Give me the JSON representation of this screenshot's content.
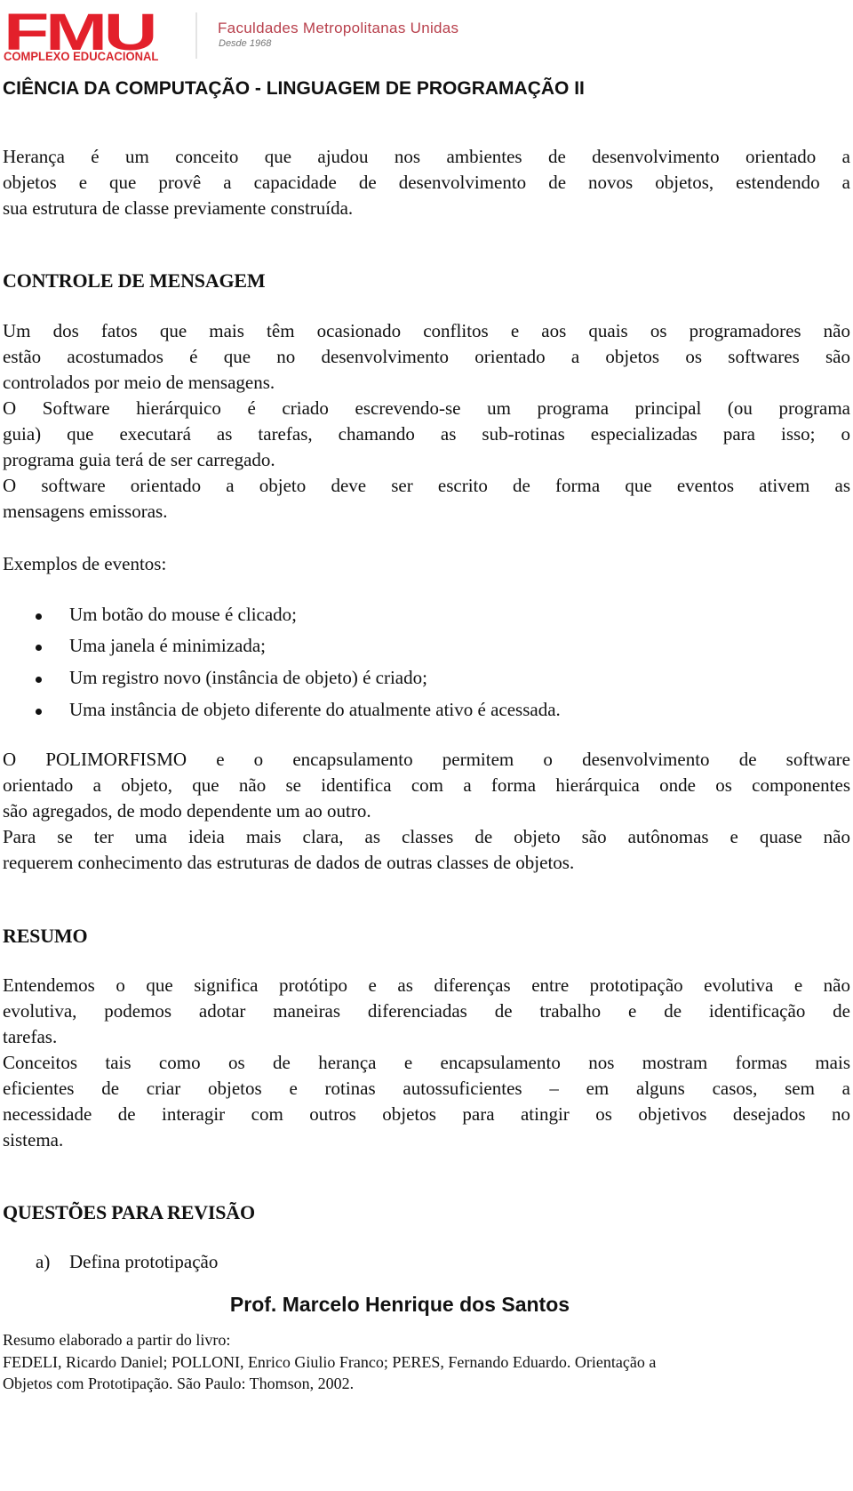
{
  "header": {
    "logo_text": "FMU",
    "logo_subtitle": "COMPLEXO EDUCACIONAL",
    "institution_name": "Faculdades Metropolitanas Unidas",
    "institution_since": "Desde 1968",
    "course_title": "CIÊNCIA DA COMPUTAÇÃO - LINGUAGEM DE PROGRAMAÇÃO II",
    "colors": {
      "brand_red": "#e3202b",
      "institution_text": "#b8404c"
    }
  },
  "intro": {
    "lines": [
      "Herança é um conceito que ajudou nos ambientes de desenvolvimento orientado a",
      "objetos e que provê a capacidade de desenvolvimento de novos objetos, estendendo a",
      "sua estrutura de classe previamente construída."
    ]
  },
  "controle": {
    "heading": "CONTROLE DE MENSAGEM",
    "paragraphs": [
      {
        "lines": [
          "Um dos fatos que mais têm ocasionado conflitos e aos quais os programadores não",
          "estão acostumados é que no desenvolvimento orientado a objetos os softwares são",
          "controlados por meio de mensagens."
        ]
      },
      {
        "lines": [
          "O Software hierárquico é criado escrevendo-se um programa principal (ou programa",
          "guia) que executará as tarefas, chamando as sub-rotinas especializadas para isso; o",
          "programa guia terá de ser carregado."
        ]
      },
      {
        "lines": [
          "O software orientado a objeto deve ser escrito de forma que eventos ativem as",
          "mensagens emissoras."
        ]
      }
    ],
    "examples_label": "Exemplos de eventos:",
    "examples": [
      "Um botão do mouse é clicado;",
      "Uma janela é minimizada;",
      "Um registro novo (instância de objeto) é criado;",
      "Uma instância de objeto diferente do atualmente ativo é acessada."
    ],
    "closing": [
      {
        "lines": [
          "O POLIMORFISMO e o encapsulamento permitem o desenvolvimento de software",
          "orientado a objeto, que não se identifica com a forma hierárquica onde os componentes",
          "são agregados, de modo dependente um ao outro."
        ]
      },
      {
        "lines": [
          "Para se ter uma ideia mais clara, as classes de objeto são autônomas e quase não",
          "requerem conhecimento das estruturas de dados de outras classes de objetos."
        ]
      }
    ]
  },
  "resumo": {
    "heading": "RESUMO",
    "paragraphs": [
      {
        "lines": [
          "Entendemos o que significa protótipo e as diferenças entre prototipação evolutiva e não",
          "evolutiva, podemos adotar maneiras diferenciadas de trabalho e de identificação de",
          "tarefas."
        ]
      },
      {
        "lines": [
          "Conceitos tais como os de herança e encapsulamento nos mostram formas mais",
          "eficientes de criar objetos e rotinas autossuficientes – em alguns casos, sem a",
          "necessidade de interagir com outros objetos para atingir os objetivos desejados no",
          "sistema."
        ]
      }
    ]
  },
  "questoes": {
    "heading": "QUESTÕES PARA REVISÃO",
    "items": [
      {
        "label": "a)",
        "text": "Defina prototipação"
      }
    ]
  },
  "footer": {
    "professor": "Prof. Marcelo Henrique dos Santos",
    "reference_lines": [
      "Resumo elaborado a partir do livro:",
      "FEDELI, Ricardo Daniel; POLLONI, Enrico Giulio Franco; PERES, Fernando Eduardo. Orientação a",
      "Objetos com Prototipação. São Paulo: Thomson, 2002."
    ]
  }
}
